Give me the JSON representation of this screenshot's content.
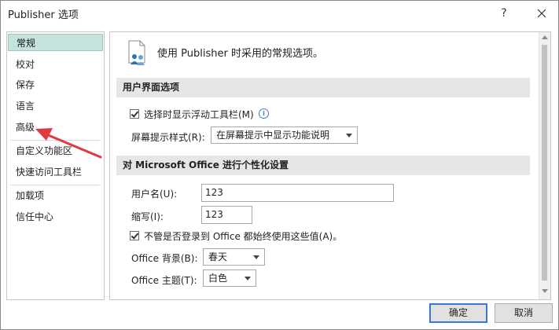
{
  "window": {
    "title": "Publisher 选项",
    "help_glyph": "?",
    "close_icon": "close-icon"
  },
  "nav": {
    "items": [
      {
        "label": "常规",
        "selected": true
      },
      {
        "label": "校对"
      },
      {
        "label": "保存"
      },
      {
        "label": "语言"
      },
      {
        "label": "高级"
      },
      {
        "label": "自定义功能区"
      },
      {
        "label": "快速访问工具栏"
      },
      {
        "label": "加载项"
      },
      {
        "label": "信任中心"
      }
    ]
  },
  "main": {
    "header": {
      "icon": "general-options-icon",
      "text": "使用 Publisher 时采用的常规选项。"
    },
    "ui_section": {
      "title": "用户界面选项",
      "mini_toolbar_label": "选择时显示浮动工具栏(M)",
      "mini_toolbar_checked": true,
      "info_glyph": "i",
      "screentip_label": "屏幕提示样式(R):",
      "screentip_value": "在屏幕提示中显示功能说明"
    },
    "personalize_section": {
      "title": "对 Microsoft Office 进行个性化设置",
      "username_label": "用户名(U):",
      "username_value": "123",
      "initials_label": "缩写(I):",
      "initials_value": "123",
      "always_use_label": "不管是否登录到 Office 都始终使用这些值(A)。",
      "always_use_checked": true,
      "background_label": "Office 背景(B):",
      "background_value": "春天",
      "theme_label": "Office 主题(T):",
      "theme_value": "白色"
    }
  },
  "footer": {
    "ok_label": "确定",
    "cancel_label": "取消"
  },
  "annotation": {
    "color": "#e0393e"
  }
}
